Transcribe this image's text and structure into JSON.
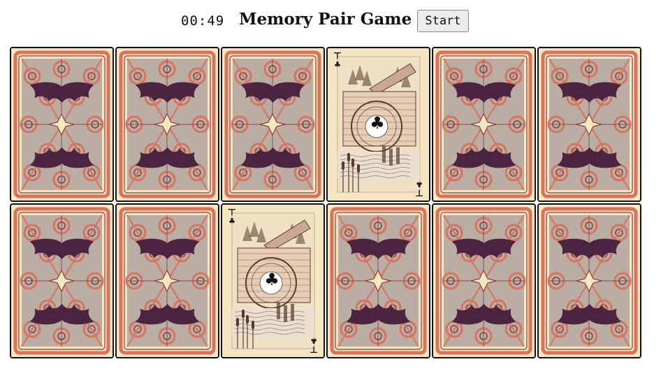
{
  "header": {
    "timer": "00:49",
    "title": "Memory Pair Game",
    "start_label": "Start"
  },
  "board": {
    "rows": 2,
    "columns": 6,
    "cards": [
      {
        "state": "face-down"
      },
      {
        "state": "face-down"
      },
      {
        "state": "face-down"
      },
      {
        "state": "face-up",
        "rank": "J",
        "suit": "clubs",
        "suit_symbol": "♣",
        "rank_glyph": "⊤"
      },
      {
        "state": "face-down"
      },
      {
        "state": "face-down"
      },
      {
        "state": "face-down"
      },
      {
        "state": "face-down"
      },
      {
        "state": "face-up",
        "rank": "J",
        "suit": "clubs",
        "suit_symbol": "♣",
        "rank_glyph": "⊤"
      },
      {
        "state": "face-down"
      },
      {
        "state": "face-down"
      },
      {
        "state": "face-down"
      }
    ]
  },
  "colors": {
    "card_border": "#111111",
    "card_paper": "#f3e6c0",
    "back_ornament": "#d9725f",
    "back_ornament_dark": "#8c3d34",
    "back_field": "#8b7f8c",
    "bat": "#4a2440",
    "face_ink": "#5a3a2e",
    "face_wash": "#c9a894"
  }
}
